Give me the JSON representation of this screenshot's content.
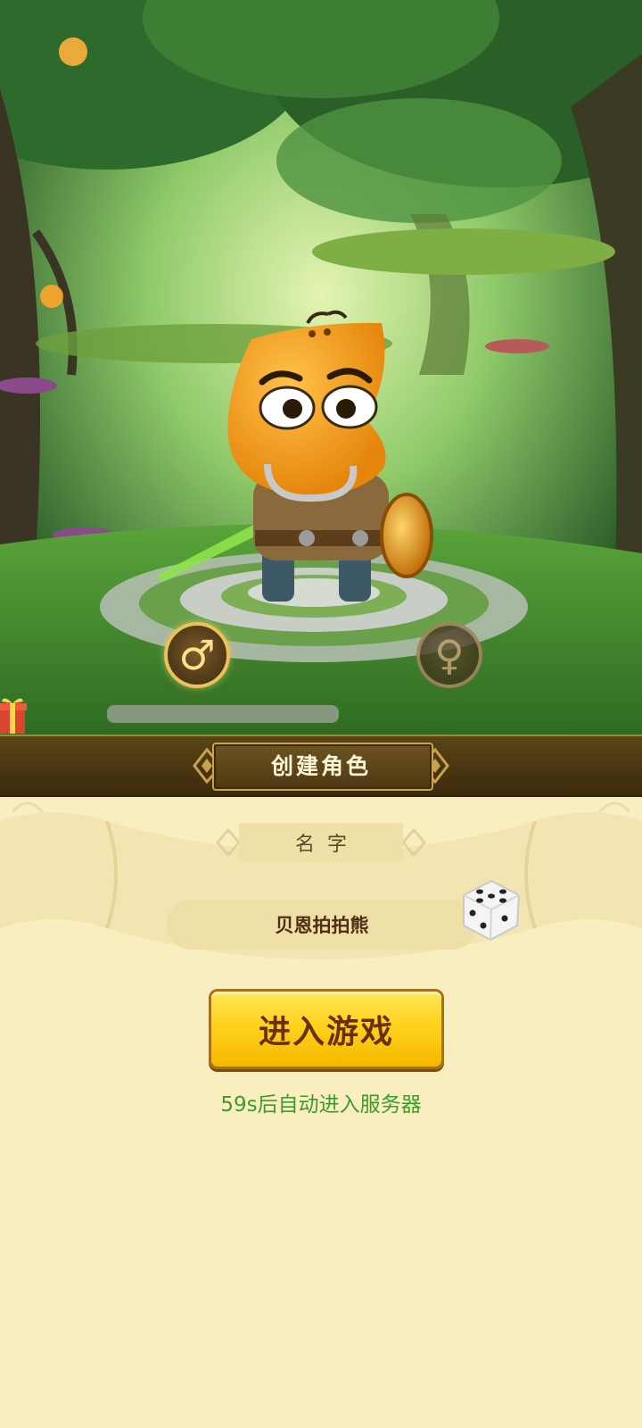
{
  "header": {
    "title": "创建角色"
  },
  "gender": {
    "male_symbol": "♂",
    "female_symbol": "♀",
    "selected": "male"
  },
  "name_section": {
    "label": "名字",
    "value": "贝恩拍拍熊"
  },
  "actions": {
    "enter_label": "进入游戏"
  },
  "status": {
    "auto_enter_text": "59s后自动进入服务器"
  },
  "colors": {
    "accent_gold": "#ffd21c",
    "status_green": "#3f9b2b",
    "panel_bg": "#f8eebf",
    "bar_brown": "#473410"
  }
}
